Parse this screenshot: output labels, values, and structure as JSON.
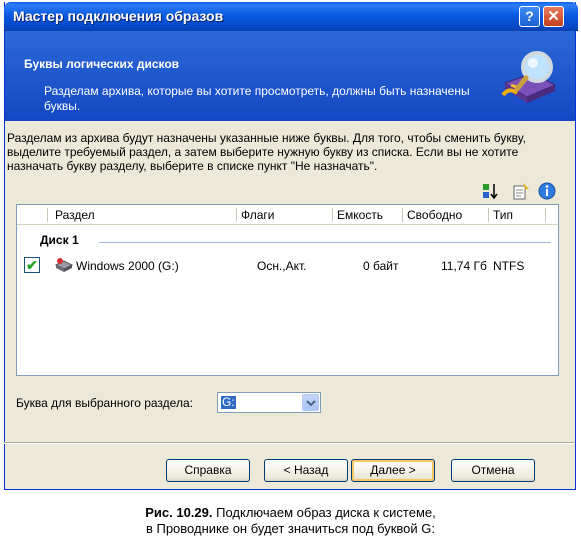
{
  "window": {
    "title": "Мастер подключения образов",
    "help_button": "?",
    "close_button": "✕"
  },
  "header": {
    "title": "Буквы логических дисков",
    "description": "Разделам архива, которые вы хотите просмотреть, должны быть назначены буквы.",
    "icon": "wizard-disk-magnifier-icon"
  },
  "instructions": "Разделам из архива будут назначены указанные ниже буквы. Для того, чтобы сменить букву, выделите требуемый раздел, а затем выберите нужную букву из списка. Если вы не хотите назначать букву разделу, выберите в списке пункт \"Не назначать\".",
  "toolbar": {
    "icons": [
      "sort-icon",
      "properties-icon",
      "info-icon"
    ]
  },
  "table": {
    "columns": [
      "Раздел",
      "Флаги",
      "Емкость",
      "Свободно",
      "Тип"
    ],
    "group": "Диск 1",
    "rows": [
      {
        "checked": true,
        "partition": "Windows 2000 (G:)",
        "flags": "Осн.,Акт.",
        "capacity": "0 байт",
        "free": "11,74 Гб",
        "type": "NTFS"
      }
    ]
  },
  "letter_select": {
    "label": "Буква для выбранного раздела:",
    "value": "G:"
  },
  "buttons": {
    "help": "Справка",
    "back": "< Назад",
    "next": "Далее >",
    "cancel": "Отмена"
  },
  "caption": {
    "figure": "Рис. 10.29.",
    "line1": "Подключаем образ диска к системе,",
    "line2": "в Проводнике он будет значиться под буквой G:"
  },
  "colors": {
    "titlebar": "#0a5ae0",
    "header": "#1f58cf",
    "dialog": "#ece9d8",
    "selection": "#316ac5"
  }
}
